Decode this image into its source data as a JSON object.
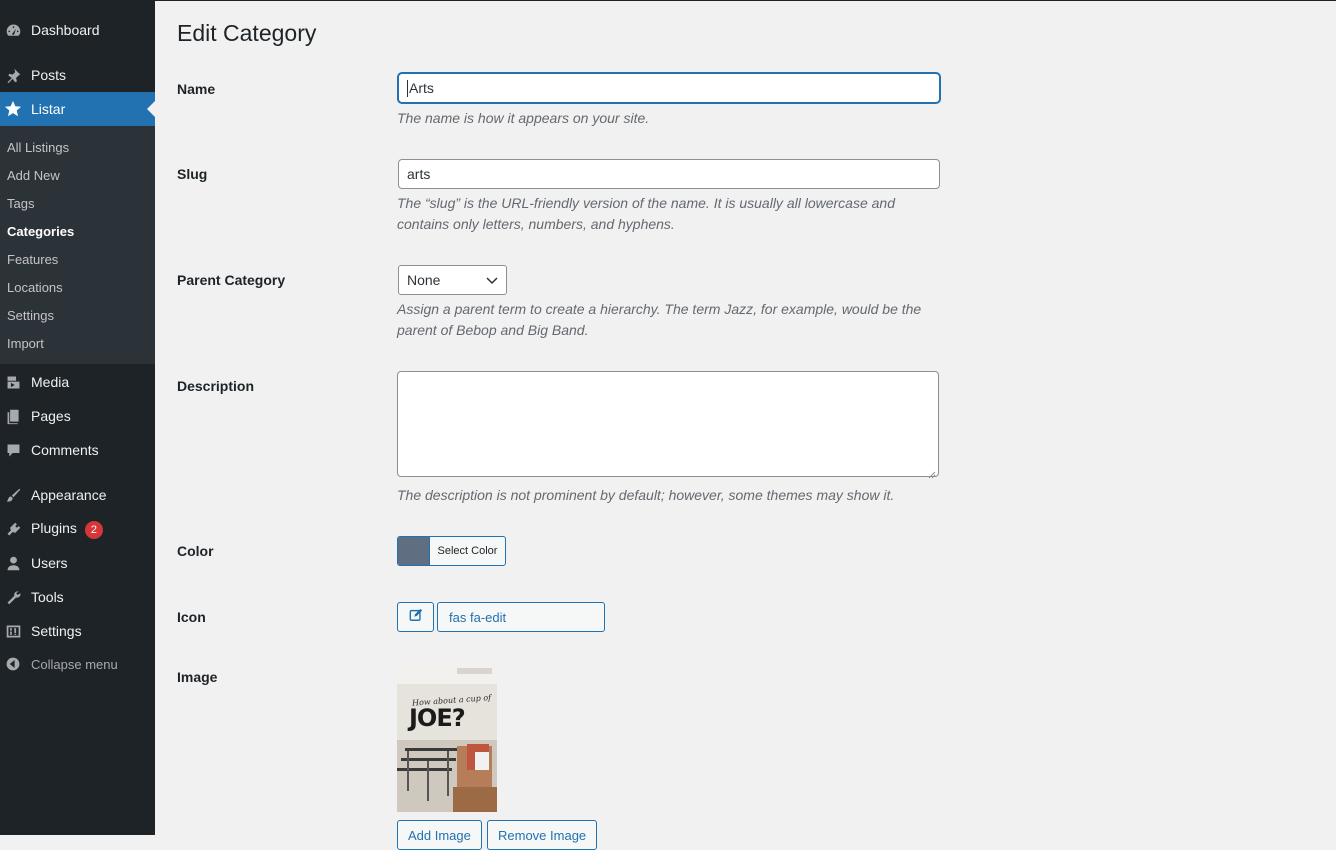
{
  "sidebar": {
    "items": [
      {
        "label": "Dashboard",
        "icon": "dashboard-icon"
      },
      {
        "label": "Posts",
        "icon": "pin-icon"
      },
      {
        "label": "Listar",
        "icon": "star-icon"
      },
      {
        "label": "Media",
        "icon": "media-icon"
      },
      {
        "label": "Pages",
        "icon": "pages-icon"
      },
      {
        "label": "Comments",
        "icon": "comments-icon"
      },
      {
        "label": "Appearance",
        "icon": "brush-icon"
      },
      {
        "label": "Plugins",
        "icon": "plugin-icon",
        "badge": "2"
      },
      {
        "label": "Users",
        "icon": "user-icon"
      },
      {
        "label": "Tools",
        "icon": "wrench-icon"
      },
      {
        "label": "Settings",
        "icon": "settings-icon"
      }
    ],
    "submenu": [
      "All Listings",
      "Add New",
      "Tags",
      "Categories",
      "Features",
      "Locations",
      "Settings",
      "Import"
    ],
    "collapse_label": "Collapse menu"
  },
  "main": {
    "title": "Edit Category",
    "name": {
      "label": "Name",
      "value": "Arts",
      "desc": "The name is how it appears on your site."
    },
    "slug": {
      "label": "Slug",
      "value": "arts",
      "desc": "The “slug” is the URL-friendly version of the name. It is usually all lowercase and contains only letters, numbers, and hyphens."
    },
    "parent": {
      "label": "Parent Category",
      "value": "None",
      "desc": "Assign a parent term to create a hierarchy. The term Jazz, for example, would be the parent of Bebop and Big Band."
    },
    "description": {
      "label": "Description",
      "value": "",
      "desc": "The description is not prominent by default; however, some themes may show it."
    },
    "color": {
      "label": "Color",
      "button": "Select Color",
      "swatch": "#5f6e80"
    },
    "icon": {
      "label": "Icon",
      "value": "fas fa-edit"
    },
    "image": {
      "label": "Image",
      "caption_top": "How about a cup of",
      "caption_main": "JOE?",
      "add": "Add Image",
      "remove": "Remove Image"
    }
  },
  "colors": {
    "sidebar_bg": "#1d2327",
    "submenu_bg": "#2c3338",
    "accent": "#2271b1",
    "badge": "#d63638"
  }
}
